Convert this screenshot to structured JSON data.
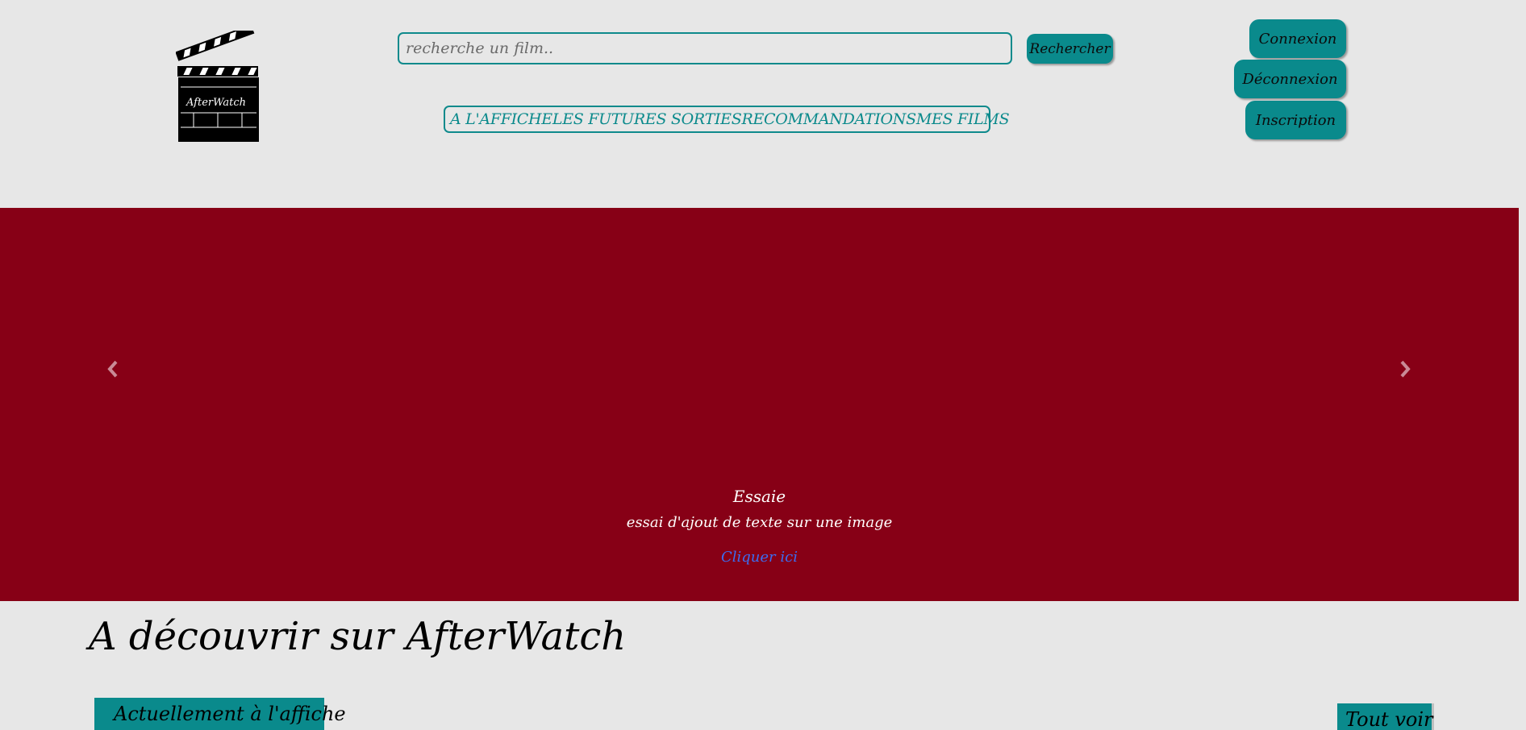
{
  "header": {
    "logo_text": "AfterWatch",
    "search": {
      "placeholder": "recherche un film..",
      "value": ""
    },
    "search_button": "Rechercher",
    "nav": [
      {
        "label": "A L'AFFICHE"
      },
      {
        "label": "LES FUTURES SORTIES"
      },
      {
        "label": "RECOMMANDATIONS"
      },
      {
        "label": "MES FILMS"
      }
    ],
    "auth": {
      "login": "Connexion",
      "logout": "Déconnexion",
      "signup": "Inscription"
    }
  },
  "carousel": {
    "title": "Essaie",
    "text": "essai d'ajout de texte sur une image",
    "link": "Cliquer ici",
    "prev_icon": "chevron-left-icon",
    "next_icon": "chevron-right-icon"
  },
  "discover": {
    "title": "A découvrir sur AfterWatch",
    "tab": "Actuellement à l'affiche",
    "see_all": "Tout voir"
  },
  "colors": {
    "accent": "#0a8a8c",
    "carousel_bg": "#870016",
    "page_bg": "#e7e7e7",
    "link": "#3d6cf0"
  }
}
